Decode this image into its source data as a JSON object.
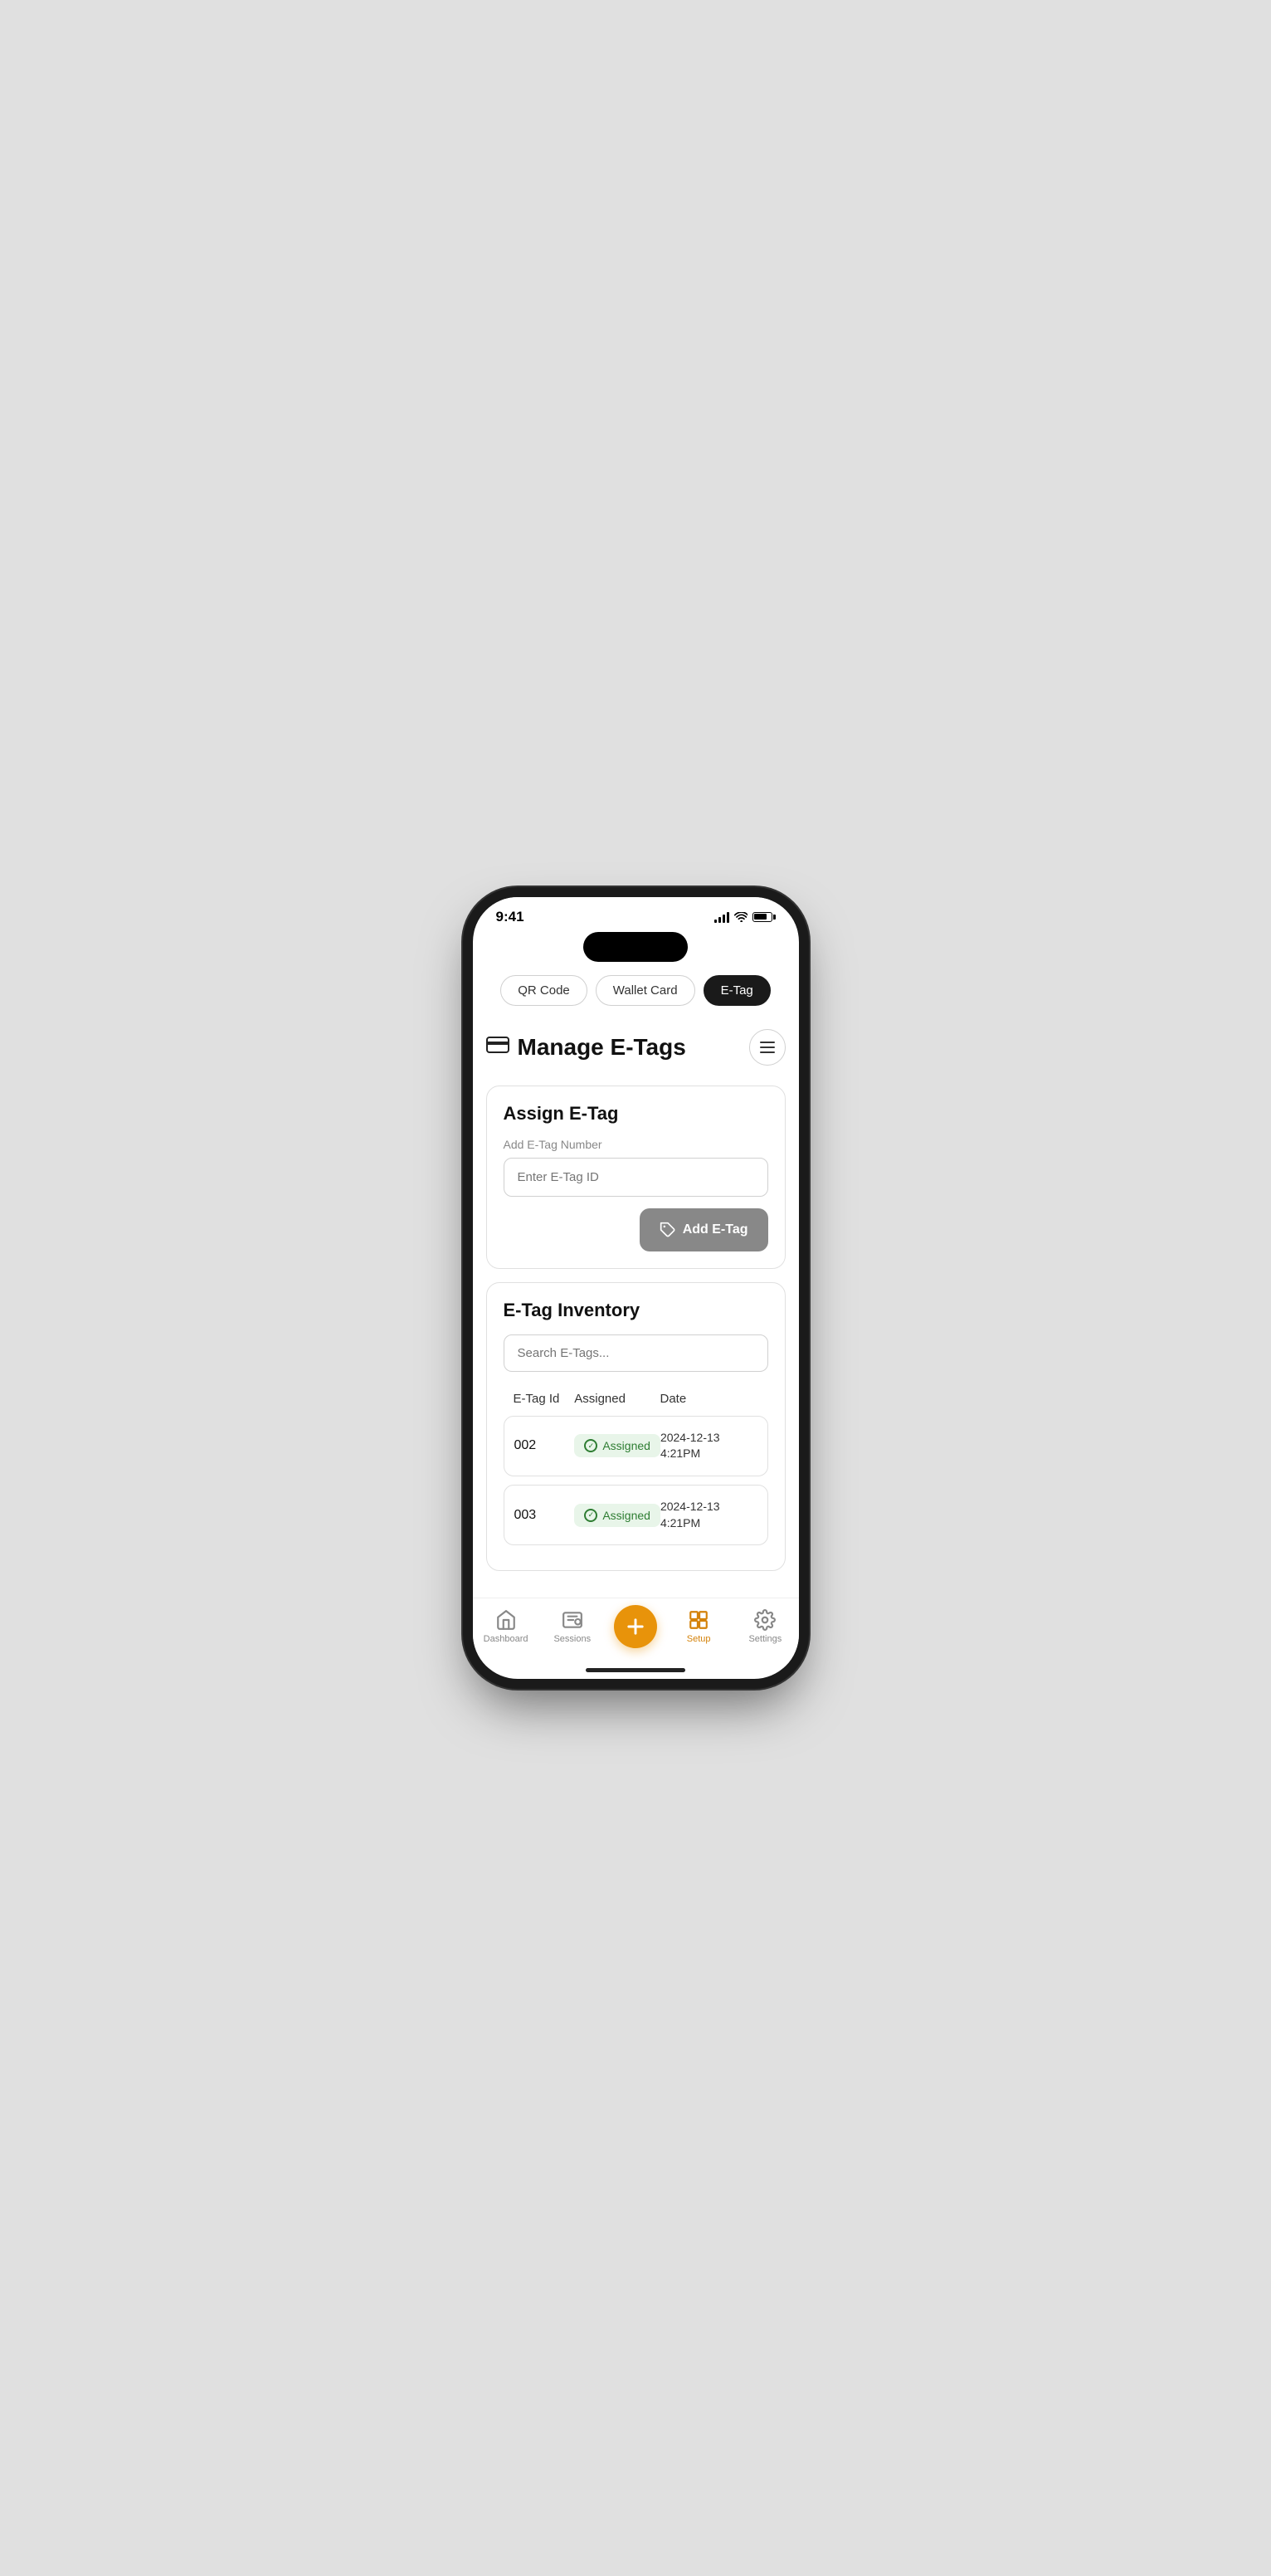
{
  "statusBar": {
    "time": "9:41"
  },
  "tabs": [
    {
      "id": "qr",
      "label": "QR Code",
      "active": false
    },
    {
      "id": "wallet",
      "label": "Wallet Card",
      "active": false
    },
    {
      "id": "etag",
      "label": "E-Tag",
      "active": true
    }
  ],
  "pageHeader": {
    "title": "Manage E-Tags",
    "iconLabel": "credit-card-icon"
  },
  "assignSection": {
    "title": "Assign E-Tag",
    "fieldLabel": "Add E-Tag Number",
    "inputPlaceholder": "Enter E-Tag ID",
    "buttonLabel": "Add E-Tag"
  },
  "inventorySection": {
    "title": "E-Tag Inventory",
    "searchPlaceholder": "Search E-Tags...",
    "columns": [
      "E-Tag Id",
      "Assigned",
      "Date"
    ],
    "rows": [
      {
        "id": "002",
        "status": "Assigned",
        "date": "2024-12-13",
        "time": "4:21PM"
      },
      {
        "id": "003",
        "status": "Assigned",
        "date": "2024-12-13",
        "time": "4:21PM"
      }
    ]
  },
  "bottomNav": [
    {
      "id": "dashboard",
      "label": "Dashboard",
      "active": false
    },
    {
      "id": "sessions",
      "label": "Sessions",
      "active": false
    },
    {
      "id": "add",
      "label": "",
      "isPlus": true
    },
    {
      "id": "setup",
      "label": "Setup",
      "active": true
    },
    {
      "id": "settings",
      "label": "Settings",
      "active": false
    }
  ]
}
